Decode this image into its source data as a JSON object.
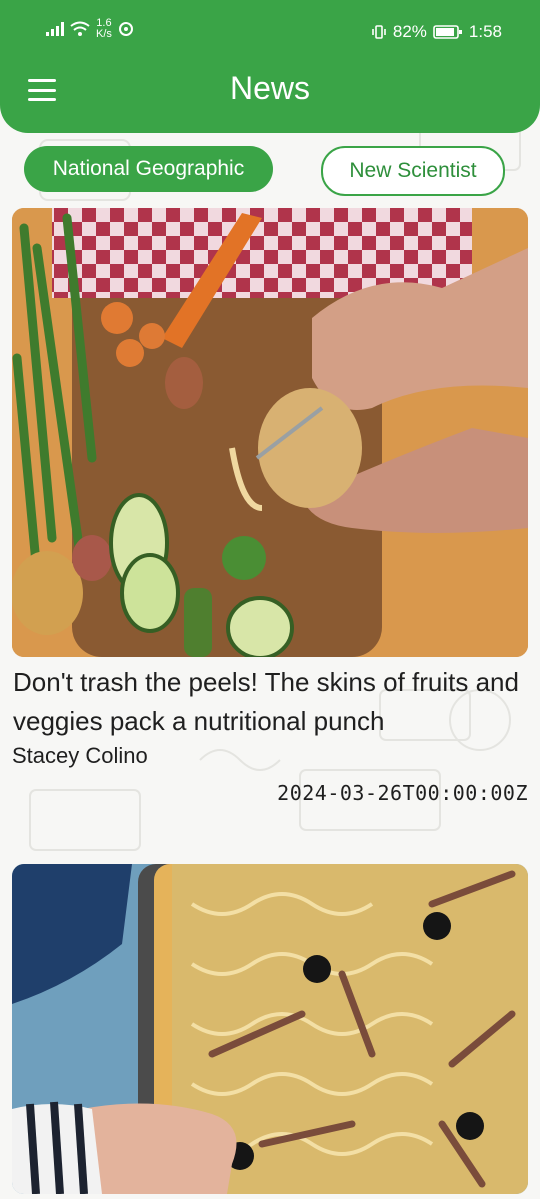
{
  "status_bar": {
    "network_speed_value": "1.6",
    "network_speed_unit": "K/s",
    "battery": "82%",
    "time": "1:58"
  },
  "app_bar": {
    "title": "News",
    "menu_icon": "hamburger-menu-icon"
  },
  "sources": {
    "tabs": [
      {
        "label": "National Geographic",
        "selected": true
      },
      {
        "label": "New Scientist",
        "selected": false
      }
    ]
  },
  "articles": [
    {
      "image_icon": "vegetable-peeling-photo",
      "headline": "Don't trash the peels! The skins of fruits and veggies pack a nutritional punch",
      "author": "Stacey Colino",
      "date": "2024-03-26T00:00:00Z"
    },
    {
      "image_icon": "onion-anchovy-tart-photo"
    }
  ],
  "colors": {
    "accent": "#3aa447",
    "background": "#f7f7f5"
  }
}
